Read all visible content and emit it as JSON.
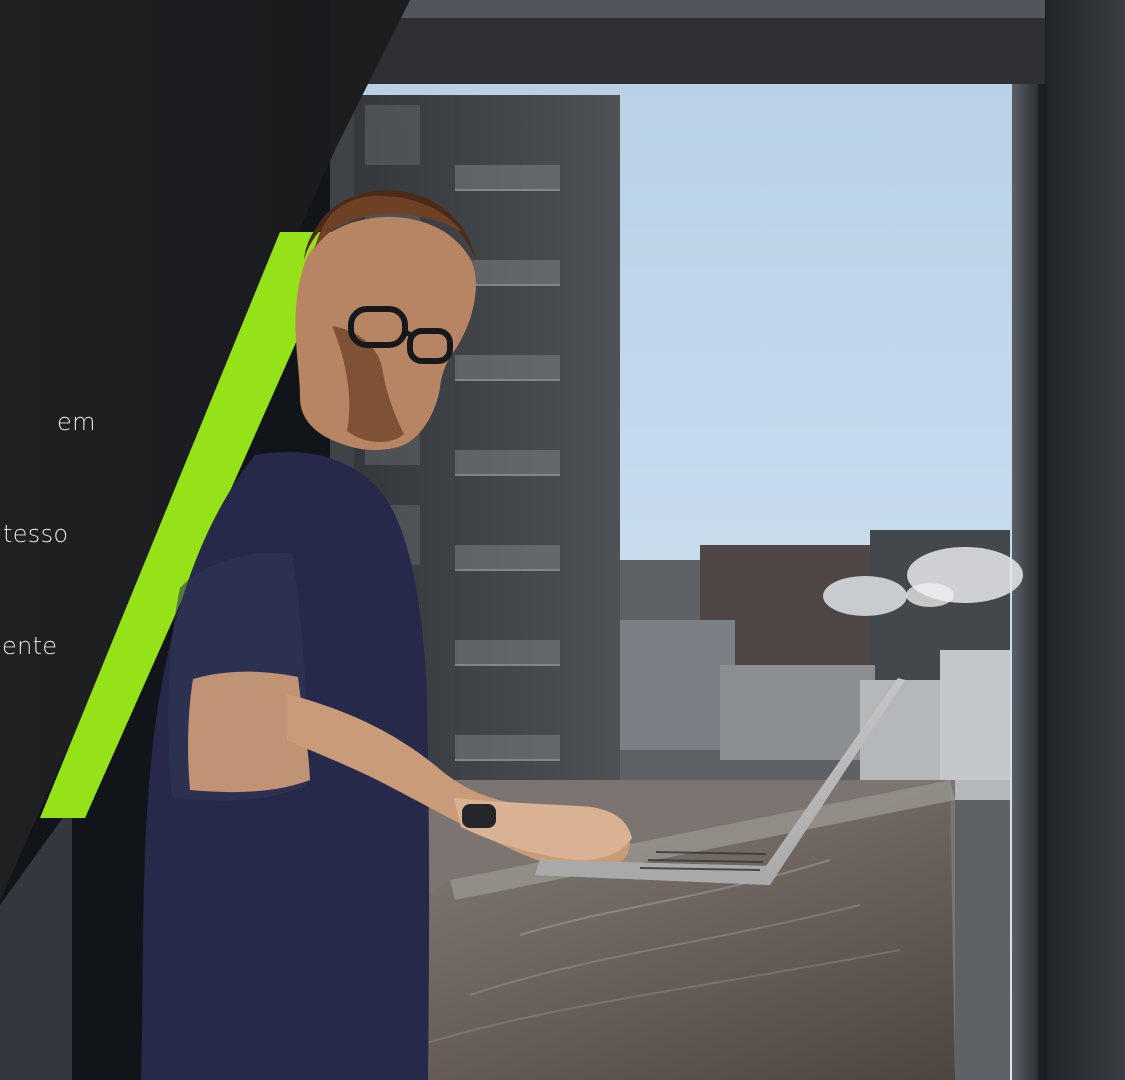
{
  "panel": {
    "lines": [
      "em",
      "tesso",
      "ente"
    ]
  },
  "colors": {
    "dark_panel": "#26282b",
    "accent_green": "#96e218",
    "sky": "#c7d9e7",
    "building_dark": "#2b2d31",
    "table": "#6a5e56",
    "shirt": "#262b48",
    "skin": "#c39573",
    "laptop": "#c8c8c8"
  }
}
